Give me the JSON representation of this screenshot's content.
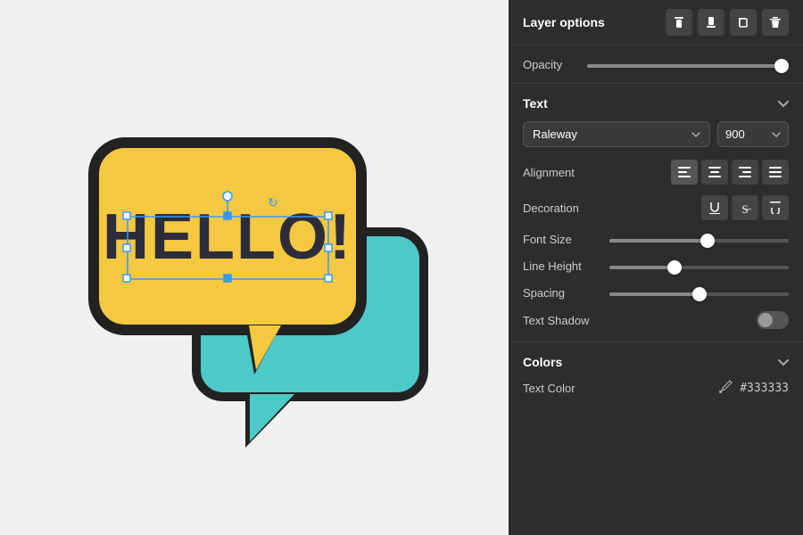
{
  "canvas": {
    "background": "#f0f0f0"
  },
  "layer_options": {
    "title": "Layer options",
    "icons": {
      "align_top": "⬆",
      "align_bottom": "⬇",
      "copy": "⧉",
      "delete": "🗑"
    }
  },
  "opacity": {
    "label": "Opacity",
    "value": 100
  },
  "text_section": {
    "title": "Text",
    "font_family": "Raleway",
    "font_weight": "900",
    "alignment": {
      "label": "Alignment",
      "buttons": [
        "align-left",
        "align-center",
        "align-right",
        "align-justify"
      ]
    },
    "decoration": {
      "label": "Decoration",
      "buttons": [
        "underline",
        "strikethrough",
        "overline"
      ]
    },
    "font_size": {
      "label": "Font Size",
      "value": 55
    },
    "line_height": {
      "label": "Line Height",
      "value": 35
    },
    "spacing": {
      "label": "Spacing",
      "value": 50
    },
    "text_shadow": {
      "label": "Text Shadow",
      "enabled": false
    }
  },
  "colors_section": {
    "title": "Colors",
    "text_color": {
      "label": "Text Color",
      "value": "#333333"
    }
  }
}
